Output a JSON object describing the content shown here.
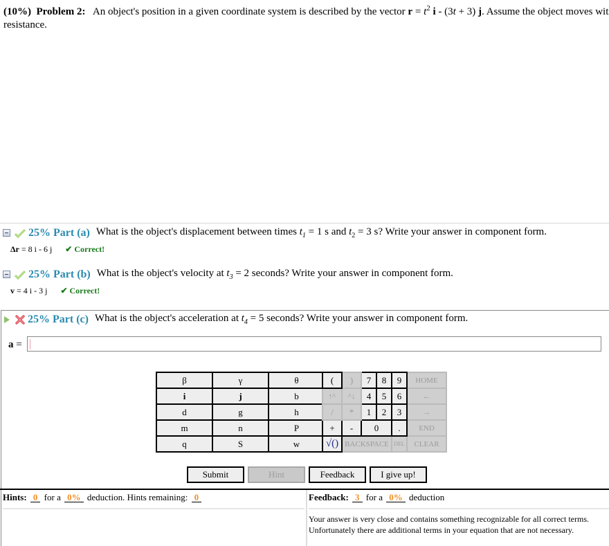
{
  "problem": {
    "weight": "(10%)",
    "title": "Problem 2:",
    "text_before": "An object's position in a given coordinate system is described by the vector",
    "vector_symbol": "r",
    "eq_sign": "=",
    "t_var": "t",
    "exp": "2",
    "i_unit": "i",
    "minus_part": "- (3",
    "t_var2": "t",
    "plus_part": "+ 3)",
    "j_unit": "j",
    "text_after": ". Assume the object moves without air",
    "line2": "resistance."
  },
  "parts": [
    {
      "status": "correct",
      "percent_label": "25% Part (a)",
      "question_pre": "What is the object's displacement between times",
      "t1": "t",
      "t1_sub": "1",
      "t1_val": "= 1 s and",
      "t2": "t",
      "t2_sub": "2",
      "t2_val": "= 3 s? Write your answer in component form.",
      "answer_lhs": "Δr",
      "answer_rhs": "= 8 i - 6 j",
      "result": "✔ Correct!"
    },
    {
      "status": "correct",
      "percent_label": "25% Part (b)",
      "question_pre": "What is the object's velocity at",
      "t": "t",
      "t_sub": "3",
      "question_post": "= 2 seconds? Write your answer in component form.",
      "answer_lhs": "v",
      "answer_rhs": "= 4 i - 3 j",
      "result": "✔ Correct!"
    },
    {
      "status": "incorrect",
      "percent_label": "25% Part (c)",
      "question_pre": "What is the object's acceleration at",
      "t": "t",
      "t_sub": "4",
      "question_post": "= 5 seconds? Write your answer in component form.",
      "input_label": "a",
      "input_eq": "=",
      "input_value": "",
      "input_placeholder": ""
    }
  ],
  "keypad": {
    "variables": [
      [
        "β",
        "γ",
        "θ"
      ],
      [
        "i",
        "j",
        "b"
      ],
      [
        "d",
        "g",
        "h"
      ],
      [
        "m",
        "n",
        "P"
      ],
      [
        "q",
        "S",
        "w"
      ]
    ],
    "ops": {
      "open_paren": "(",
      "close_paren": ")",
      "up_caret": "↑^",
      "caret_down": "^↓",
      "divide": "/",
      "multiply": "*",
      "plus": "+",
      "minus": "-",
      "sqrt": "√()",
      "backspace": "BACKSPACE",
      "del": "DEL",
      "decimal": "."
    },
    "digits": [
      "7",
      "8",
      "9",
      "4",
      "5",
      "6",
      "1",
      "2",
      "3",
      "0"
    ],
    "nav": {
      "home": "HOME",
      "left": "←",
      "right": "→",
      "end": "END",
      "clear": "CLEAR"
    }
  },
  "buttons": {
    "submit": "Submit",
    "hint": "Hint",
    "feedback": "Feedback",
    "give_up": "I give up!"
  },
  "hints": {
    "label": "Hints:",
    "count": "0",
    "for_a": "for a",
    "deduction": "0%",
    "text": "deduction. Hints remaining:",
    "remaining": "0"
  },
  "feedback": {
    "label": "Feedback:",
    "count": "3",
    "for_a": "for a",
    "deduction": "0%",
    "text": "deduction",
    "message": "Your answer is very close and contains something recognizable for all correct terms. Unfortunately there are additional terms in your equation that are not necessary."
  },
  "colors": {
    "part_title": "#2a8ab0",
    "correct": "#1a7a1a",
    "counter": "#f0902a"
  }
}
